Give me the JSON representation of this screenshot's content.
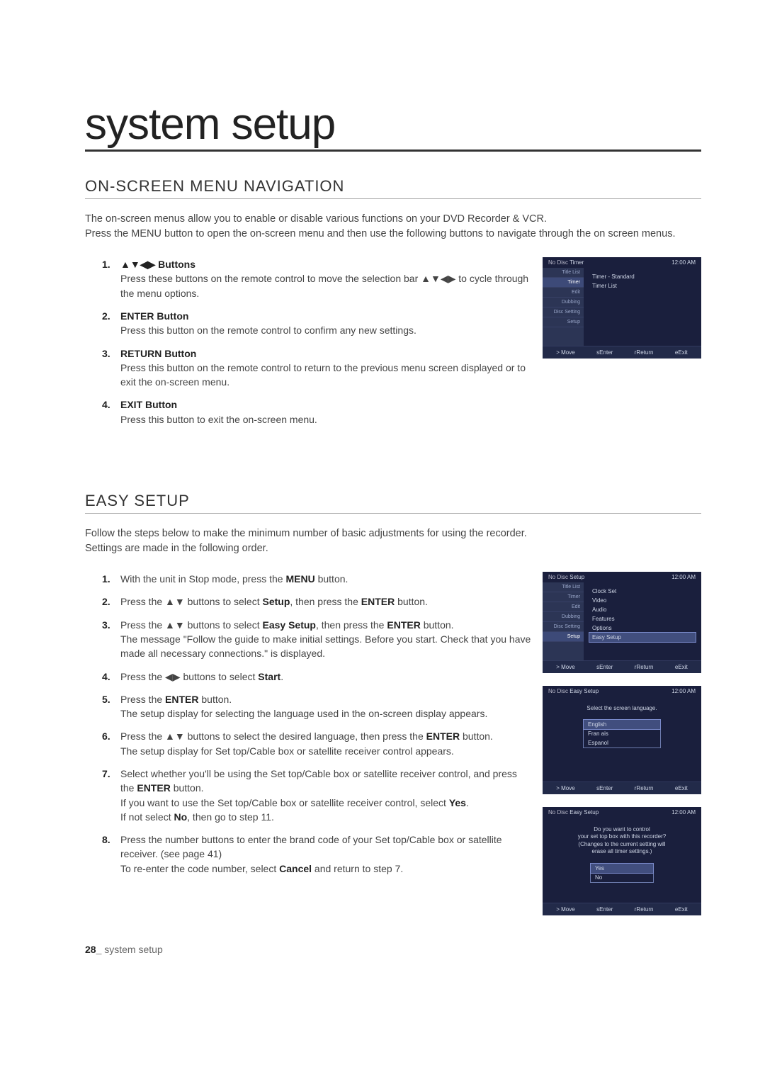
{
  "title": "system setup",
  "section1": {
    "heading": "ON-SCREEN MENU NAVIGATION",
    "intro": "The on-screen menus allow you to enable or disable various functions on your DVD Recorder & VCR.\nPress the MENU button to open the on-screen menu and then use the following buttons to navigate through the on screen menus.",
    "items": [
      {
        "num": "1.",
        "label": "▲▼◀▶ Buttons",
        "text": "Press these buttons on the remote control to move the selection bar ▲▼◀▶ to cycle through the menu options."
      },
      {
        "num": "2.",
        "label": "ENTER Button",
        "text": "Press this button on the remote control to confirm any new settings."
      },
      {
        "num": "3.",
        "label": "RETURN Button",
        "text": "Press this button on the remote control to return to the previous menu screen displayed or to exit the on-screen menu."
      },
      {
        "num": "4.",
        "label": "EXIT Button",
        "text": "Press this button to exit the on-screen menu."
      }
    ]
  },
  "section2": {
    "heading": "EASY SETUP",
    "intro": "Follow the steps below to make the minimum number of basic adjustments for using the recorder.\nSettings are made in the following order.",
    "items": [
      {
        "num": "1.",
        "text_pre": "With the unit in Stop mode, press the ",
        "bold1": "MENU",
        "text_post": " button."
      },
      {
        "num": "2.",
        "text_pre": "Press the ▲▼ buttons to select ",
        "bold1": "Setup",
        "text_mid": ", then press the ",
        "bold2": "ENTER",
        "text_post": " button."
      },
      {
        "num": "3.",
        "text_pre": "Press the ▲▼ buttons to select ",
        "bold1": "Easy Setup",
        "text_mid": ", then press the ",
        "bold2": "ENTER",
        "text_post": " button.",
        "extra": "The message \"Follow the guide to make initial settings. Before you start. Check that you have made all necessary connections.\" is displayed."
      },
      {
        "num": "4.",
        "text_pre": "Press the ◀▶ buttons to select ",
        "bold1": "Start",
        "text_post": "."
      },
      {
        "num": "5.",
        "text_pre": "Press the ",
        "bold1": "ENTER",
        "text_post": " button.",
        "extra": "The setup display for selecting the language used in the on-screen display appears."
      },
      {
        "num": "6.",
        "text_pre": "Press the ▲▼ buttons to select the desired language, then press the ",
        "bold1": "ENTER",
        "text_post": " button.",
        "extra": "The setup display for Set top/Cable box or satellite receiver control appears."
      },
      {
        "num": "7.",
        "text_pre": "Select whether you'll be using the Set top/Cable box or satellite receiver control, and press the ",
        "bold1": "ENTER",
        "text_post": " button.",
        "extra": "If you want to use the Set top/Cable box or satellite receiver control, select ",
        "extra_bold": "Yes",
        "extra2": ".\nIf not select ",
        "extra_bold2": "No",
        "extra3": ", then go to step 11."
      },
      {
        "num": "8.",
        "text_pre": "Press the number buttons to enter the brand code of your Set top/Cable box or satellite receiver. (see page 41)",
        "extra": "To re-enter the code number, select ",
        "extra_bold": "Cancel",
        "extra2": " and return to step 7."
      }
    ]
  },
  "osd_common": {
    "disc": "No Disc",
    "time": "12:00 AM",
    "footer": {
      "move": "> Move",
      "enter": "sEnter",
      "return": "rReturn",
      "exit": "eExit"
    },
    "sidebar": [
      "Title List",
      "Timer",
      "Edit",
      "Dubbing",
      "Disc Setting",
      "Setup"
    ]
  },
  "osd1": {
    "crumb": "Timer",
    "active_sidebar": 1,
    "main": [
      "Timer - Standard",
      "Timer List"
    ]
  },
  "osd2": {
    "crumb": "Setup",
    "active_sidebar": 5,
    "main": [
      "Clock Set",
      "Video",
      "Audio",
      "Features",
      "Options",
      "Easy Setup"
    ],
    "highlight": 5
  },
  "osd3": {
    "crumb": "Easy Setup",
    "prompt": "Select the screen language.",
    "options": [
      "English",
      "Fran ais",
      "Espanol"
    ],
    "highlight": 0
  },
  "osd4": {
    "crumb": "Easy Setup",
    "prompt": "Do you want to control\nyour set top box with this recorder?\n(Changes to the current setting will\nerase all timer settings.)",
    "options": [
      "Yes",
      "No"
    ],
    "highlight": 0
  },
  "footer": {
    "page": "28_",
    "label": " system setup"
  }
}
